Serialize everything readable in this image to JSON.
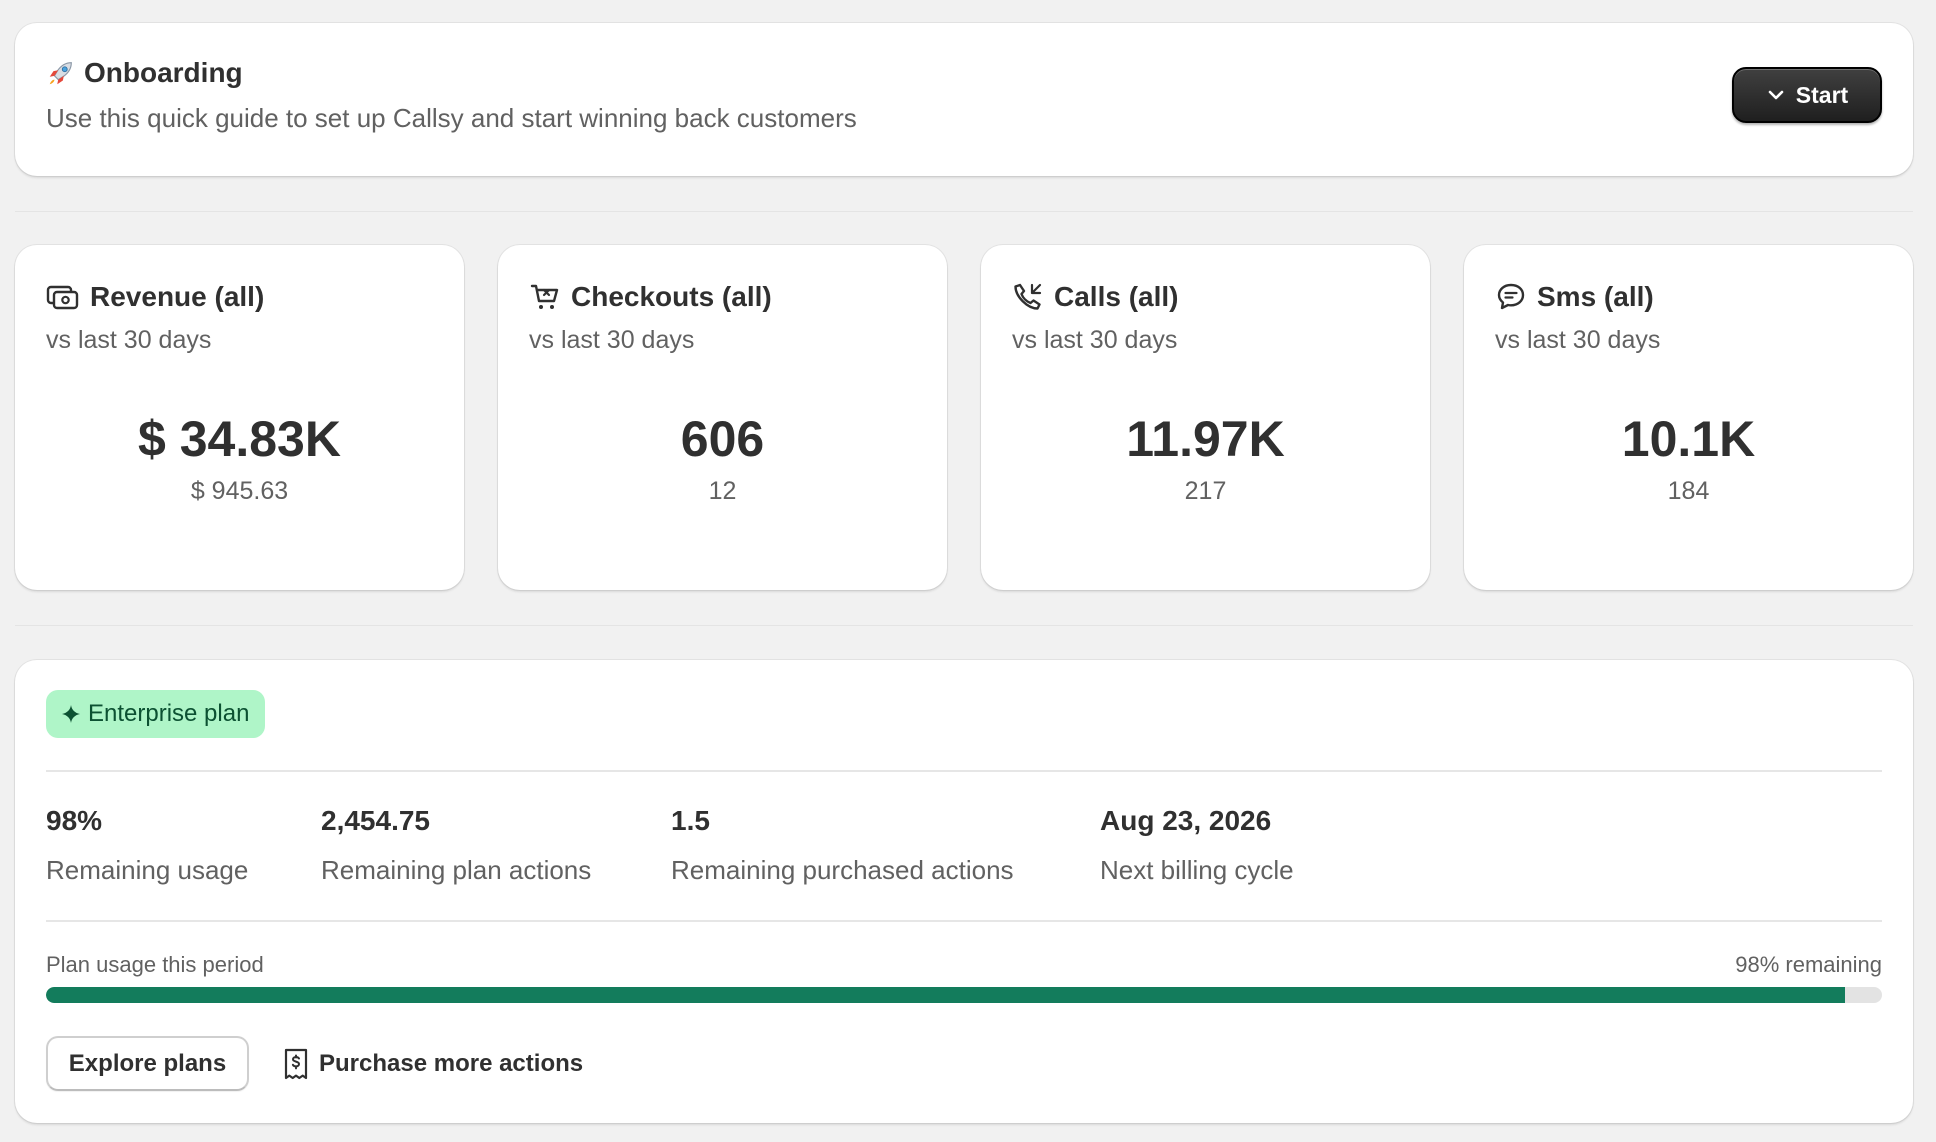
{
  "onboarding": {
    "icon": "rocket-icon",
    "title": "Onboarding",
    "subtitle": "Use this quick guide to set up Callsy and start winning back customers",
    "start_label": "Start"
  },
  "metrics": [
    {
      "icon": "cash-icon",
      "title": "Revenue (all)",
      "subtitle": "vs last 30 days",
      "value": "$ 34.83K",
      "previous": "$ 945.63"
    },
    {
      "icon": "cart-icon",
      "title": "Checkouts (all)",
      "subtitle": "vs last 30 days",
      "value": "606",
      "previous": "12"
    },
    {
      "icon": "phone-icon",
      "title": "Calls (all)",
      "subtitle": "vs last 30 days",
      "value": "11.97K",
      "previous": "217"
    },
    {
      "icon": "chat-icon",
      "title": "Sms (all)",
      "subtitle": "vs last 30 days",
      "value": "10.1K",
      "previous": "184"
    }
  ],
  "plan": {
    "badge_label": "Enterprise plan",
    "badge_color": "#aff5c8",
    "stats": [
      {
        "value": "98%",
        "label": "Remaining usage"
      },
      {
        "value": "2,454.75",
        "label": "Remaining plan actions"
      },
      {
        "value": "1.5",
        "label": "Remaining purchased actions"
      },
      {
        "value": "Aug 23, 2026",
        "label": "Next billing cycle"
      }
    ],
    "usage_label": "Plan usage this period",
    "usage_remaining_text": "98% remaining",
    "usage_fraction": 0.98,
    "bar_color": "#137c5c",
    "explore_label": "Explore plans",
    "purchase_label": "Purchase more actions"
  }
}
